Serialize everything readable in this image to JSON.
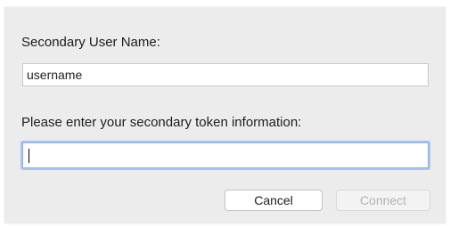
{
  "dialog": {
    "user_label": "Secondary User Name:",
    "user_value": "username",
    "token_label": "Please enter your secondary token information:",
    "token_value": "",
    "buttons": {
      "cancel": "Cancel",
      "connect": "Connect"
    }
  }
}
